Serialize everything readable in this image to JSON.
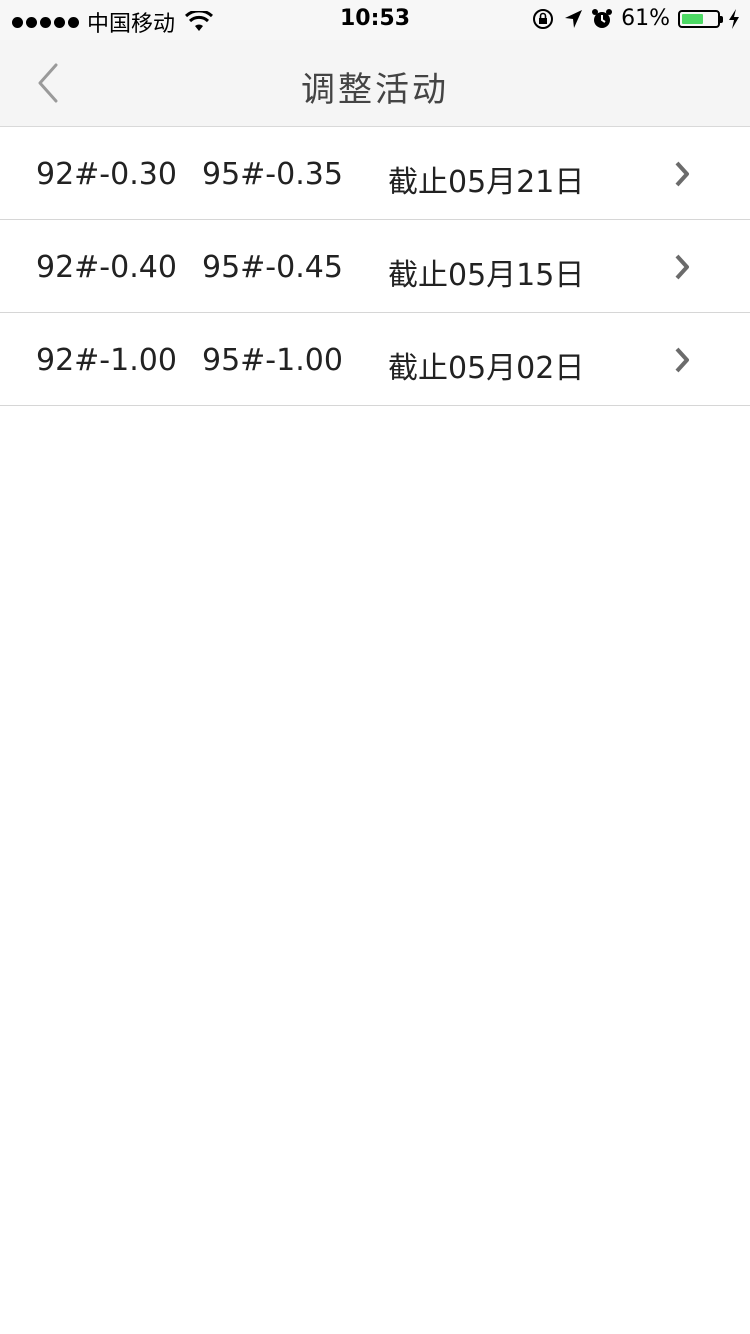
{
  "status_bar": {
    "carrier": "中国移动",
    "time": "10:53",
    "battery_percent": "61%",
    "battery_level": 0.61,
    "icons": [
      "signal-dots-icon",
      "wifi-icon",
      "rotation-lock-icon",
      "location-arrow-icon",
      "alarm-icon",
      "battery-icon",
      "charging-bolt-icon"
    ]
  },
  "nav": {
    "title": "调整活动",
    "back_icon": "chevron-left-icon"
  },
  "activities": [
    {
      "grade92": "92#-0.30",
      "grade95": "95#-0.35",
      "deadline": "截止05月21日"
    },
    {
      "grade92": "92#-0.40",
      "grade95": "95#-0.45",
      "deadline": "截止05月15日"
    },
    {
      "grade92": "92#-1.00",
      "grade95": "95#-1.00",
      "deadline": "截止05月02日"
    }
  ],
  "colors": {
    "nav_background": "#f5f5f5",
    "battery_fill": "#4cd964",
    "separator": "#d6d6d6"
  }
}
